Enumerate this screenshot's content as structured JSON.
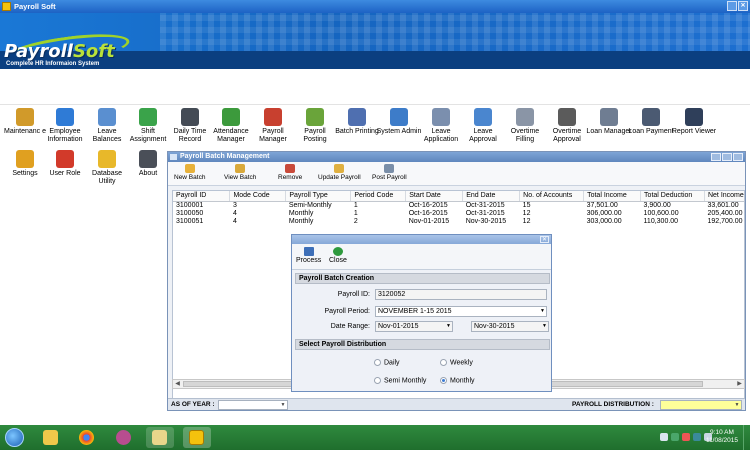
{
  "window": {
    "title": "Payroll Soft"
  },
  "brand": {
    "logo_part1": "Payroll",
    "logo_part2": "Soft",
    "tagline": "Complete HR Informaion System"
  },
  "launcher": {
    "row1": [
      {
        "label": "Maintenanc e",
        "icon": "box-icon",
        "color": "#d19a2a"
      },
      {
        "label": "Employee Information",
        "icon": "people-icon",
        "color": "#2f7bd6"
      },
      {
        "label": "Leave Balances",
        "icon": "document-icon",
        "color": "#5a8fd0"
      },
      {
        "label": "Shift Assignment",
        "icon": "clock-icon",
        "color": "#3aa34a"
      },
      {
        "label": "Daily Time Record",
        "icon": "calendar-icon",
        "color": "#444b55"
      },
      {
        "label": "Attendance Manager",
        "icon": "cubes-icon",
        "color": "#3c9a3c"
      },
      {
        "label": "Payroll Manager",
        "icon": "money-icon",
        "color": "#c8402f"
      },
      {
        "label": "Payroll Posting",
        "icon": "pen-icon",
        "color": "#6aa43a"
      },
      {
        "label": "Batch Printing",
        "icon": "printer-icon",
        "color": "#4f6fb0"
      },
      {
        "label": "System Admin",
        "icon": "admin-icon",
        "color": "#3d7cc9"
      },
      {
        "label": "Leave Application",
        "icon": "form-icon",
        "color": "#7b8fae"
      },
      {
        "label": "Leave Approval",
        "icon": "chart-icon",
        "color": "#4a86cf"
      },
      {
        "label": "Overtime Filling",
        "icon": "doc-icon",
        "color": "#8a95a6"
      },
      {
        "label": "Overtime Approval",
        "icon": "checklist-icon",
        "color": "#5b5b5b"
      },
      {
        "label": "Loan Manager",
        "icon": "clipboard-icon",
        "color": "#6f7d92"
      },
      {
        "label": "Loan Payment",
        "icon": "receipt-icon",
        "color": "#4b5a72"
      },
      {
        "label": "Report Viewer",
        "icon": "report-icon",
        "color": "#2f3f5a"
      }
    ],
    "row2": [
      {
        "label": "Settings",
        "icon": "gear-icon",
        "color": "#e0a020"
      },
      {
        "label": "User Role",
        "icon": "userrole-icon",
        "color": "#d23a2a"
      },
      {
        "label": "Database Utility",
        "icon": "database-icon",
        "color": "#e8b82a"
      },
      {
        "label": "About",
        "icon": "help-icon",
        "color": "#4a4f58"
      }
    ]
  },
  "batch_window": {
    "title": "Payroll Batch Management",
    "toolbar": [
      {
        "label": "New Batch",
        "icon": "new-batch-icon",
        "color": "#e7b13a"
      },
      {
        "label": "View Batch",
        "icon": "view-batch-icon",
        "color": "#d9a93b"
      },
      {
        "label": "Remove",
        "icon": "remove-icon",
        "color": "#c94a3a"
      },
      {
        "label": "Update Payroll",
        "icon": "update-icon",
        "color": "#e0b040"
      },
      {
        "label": "Post Payroll",
        "icon": "post-icon",
        "color": "#7a8ea8"
      }
    ],
    "columns": [
      "Payroll ID",
      "Mode Code",
      "Payroll Type",
      "Period Code",
      "Start Date",
      "End Date",
      "No. of Accounts",
      "Total Income",
      "Total Deduction",
      "Net Income"
    ],
    "rows": [
      [
        "3100001",
        "3",
        "Semi-Monthly",
        "1",
        "Oct-16-2015",
        "Oct-31-2015",
        "15",
        "37,501.00",
        "3,900.00",
        "33,601.00"
      ],
      [
        "3100050",
        "4",
        "Monthly",
        "1",
        "Oct-16-2015",
        "Oct-31-2015",
        "12",
        "306,000.00",
        "100,600.00",
        "205,400.00"
      ],
      [
        "3100051",
        "4",
        "Monthly",
        "2",
        "Nov-01-2015",
        "Nov-30-2015",
        "12",
        "303,000.00",
        "110,300.00",
        "192,700.00"
      ]
    ],
    "as_of_year_label": "AS OF YEAR :",
    "as_of_year_value": "",
    "distribution_label": "PAYROLL DISTRIBUTION :",
    "distribution_value": ""
  },
  "dialog": {
    "toolbar": [
      {
        "label": "Process",
        "icon": "save-icon"
      },
      {
        "label": "Close",
        "icon": "refresh-icon"
      }
    ],
    "section1": "Payroll Batch Creation",
    "payroll_id_label": "Payroll ID:",
    "payroll_id_value": "3120052",
    "period_label": "Payroll Period:",
    "period_value": "NOVEMBER 1-15 2015",
    "range_label": "Date Range:",
    "range_from": "Nov-01-2015",
    "range_to": "Nov-30-2015",
    "section2": "Select Payroll Distribution",
    "options": [
      {
        "label": "Daily",
        "selected": false
      },
      {
        "label": "Weekly",
        "selected": false
      },
      {
        "label": "Semi Monthly",
        "selected": false
      },
      {
        "label": "Monthly",
        "selected": true
      }
    ]
  },
  "taskbar": {
    "time": "9:10 AM",
    "date": "11/08/2015"
  },
  "colors": {
    "accent": "#1d62c4",
    "taskbar": "#2f8a3e",
    "distribution_field": "#ffff99"
  }
}
